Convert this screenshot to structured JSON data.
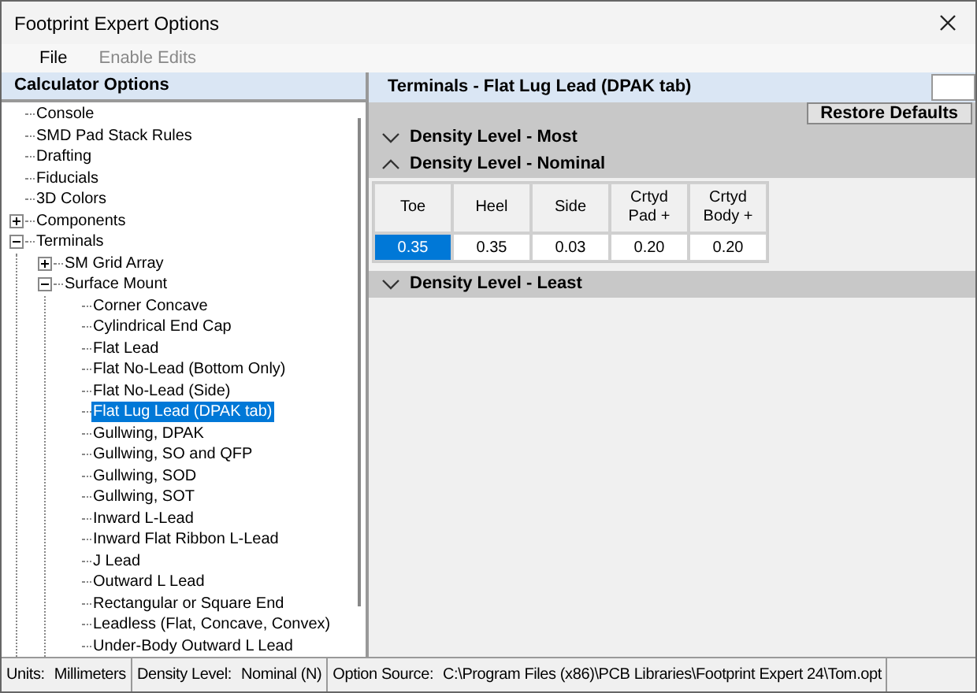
{
  "window": {
    "title": "Footprint Expert Options"
  },
  "menu": [
    {
      "label": "File",
      "disabled": false
    },
    {
      "label": "Enable Edits",
      "disabled": true
    }
  ],
  "sidebar": {
    "title": "Calculator Options",
    "tree": [
      {
        "label": "Console",
        "kind": "leaf",
        "selected": false
      },
      {
        "label": "SMD Pad Stack Rules",
        "kind": "leaf",
        "selected": false
      },
      {
        "label": "Drafting",
        "kind": "leaf",
        "selected": false
      },
      {
        "label": "Fiducials",
        "kind": "leaf",
        "selected": false
      },
      {
        "label": "3D Colors",
        "kind": "leaf",
        "selected": false
      },
      {
        "label": "Components",
        "kind": "folder",
        "expanded": false,
        "selected": false
      },
      {
        "label": "Terminals",
        "kind": "folder",
        "expanded": true,
        "selected": false,
        "children": [
          {
            "label": "SM Grid Array",
            "kind": "folder",
            "expanded": false,
            "selected": false
          },
          {
            "label": "Surface Mount",
            "kind": "folder",
            "expanded": true,
            "selected": false,
            "children": [
              {
                "label": "Corner Concave",
                "kind": "leaf",
                "selected": false
              },
              {
                "label": "Cylindrical End Cap",
                "kind": "leaf",
                "selected": false
              },
              {
                "label": "Flat Lead",
                "kind": "leaf",
                "selected": false
              },
              {
                "label": "Flat No-Lead (Bottom Only)",
                "kind": "leaf",
                "selected": false
              },
              {
                "label": "Flat No-Lead (Side)",
                "kind": "leaf",
                "selected": false
              },
              {
                "label": "Flat Lug Lead (DPAK tab)",
                "kind": "leaf",
                "selected": true
              },
              {
                "label": "Gullwing, DPAK",
                "kind": "leaf",
                "selected": false
              },
              {
                "label": "Gullwing, SO and QFP",
                "kind": "leaf",
                "selected": false
              },
              {
                "label": "Gullwing, SOD",
                "kind": "leaf",
                "selected": false
              },
              {
                "label": "Gullwing, SOT",
                "kind": "leaf",
                "selected": false
              },
              {
                "label": "Inward L-Lead",
                "kind": "leaf",
                "selected": false
              },
              {
                "label": "Inward Flat Ribbon L-Lead",
                "kind": "leaf",
                "selected": false
              },
              {
                "label": "J Lead",
                "kind": "leaf",
                "selected": false
              },
              {
                "label": "Outward L Lead",
                "kind": "leaf",
                "selected": false
              },
              {
                "label": "Rectangular or Square End",
                "kind": "leaf",
                "selected": false
              },
              {
                "label": "Leadless (Flat, Concave, Convex)",
                "kind": "leaf",
                "selected": false
              },
              {
                "label": "Under-Body Outward L Lead",
                "kind": "leaf",
                "selected": false
              }
            ]
          }
        ]
      }
    ]
  },
  "panel": {
    "title": "Terminals - Flat Lug Lead (DPAK tab)",
    "restore_button": "Restore Defaults",
    "sections": [
      {
        "title": "Density Level - Most",
        "expanded": false
      },
      {
        "title": "Density Level - Nominal",
        "expanded": true,
        "columns": [
          "Toe",
          "Heel",
          "Side",
          "Crtyd\nPad +",
          "Crtyd\nBody +"
        ],
        "cells": [
          {
            "value": "0.35",
            "selected": true
          },
          {
            "value": "0.35",
            "selected": false
          },
          {
            "value": "0.03",
            "selected": false
          },
          {
            "value": "0.20",
            "selected": false
          },
          {
            "value": "0.20",
            "selected": false
          }
        ]
      },
      {
        "title": "Density Level - Least",
        "expanded": false
      }
    ]
  },
  "status_bar": [
    {
      "label": "Units:",
      "value": "Millimeters"
    },
    {
      "label": "Density Level:",
      "value": "Nominal (N)"
    },
    {
      "label": "Option Source:",
      "value": "C:\\Program Files (x86)\\PCB Libraries\\Footprint Expert 24\\Tom.opt"
    }
  ]
}
